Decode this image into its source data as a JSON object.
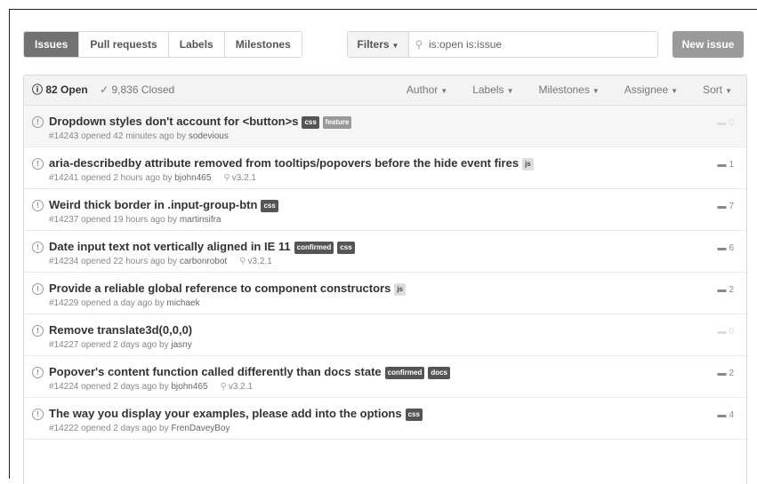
{
  "nav": {
    "tabs": [
      {
        "label": "Issues"
      },
      {
        "label": "Pull requests"
      },
      {
        "label": "Labels"
      },
      {
        "label": "Milestones"
      }
    ],
    "filters_label": "Filters",
    "search_value": "is:open is:issue",
    "new_issue_label": "New issue"
  },
  "header": {
    "open_label": "82 Open",
    "closed_label": "9,836 Closed",
    "menus": [
      "Author",
      "Labels",
      "Milestones",
      "Assignee",
      "Sort"
    ]
  },
  "issues": [
    {
      "title": "Dropdown styles don't account for <button>s",
      "labels": [
        "css",
        "feature"
      ],
      "number": "#14243",
      "opened": "opened 42 minutes ago by",
      "author": "sodevious",
      "milestone": "",
      "comments": "0"
    },
    {
      "title": "aria-describedby attribute removed from tooltips/popovers before the hide event fires",
      "labels": [
        "js"
      ],
      "number": "#14241",
      "opened": "opened 2 hours ago by",
      "author": "bjohn465",
      "milestone": "v3.2.1",
      "comments": "1"
    },
    {
      "title": "Weird thick border in .input-group-btn",
      "labels": [
        "css"
      ],
      "number": "#14237",
      "opened": "opened 19 hours ago by",
      "author": "martinsifra",
      "milestone": "",
      "comments": "7"
    },
    {
      "title": "Date input text not vertically aligned in IE 11",
      "labels": [
        "confirmed",
        "css"
      ],
      "number": "#14234",
      "opened": "opened 22 hours ago by",
      "author": "carbonrobot",
      "milestone": "v3.2.1",
      "comments": "6"
    },
    {
      "title": "Provide a reliable global reference to component constructors",
      "labels": [
        "js"
      ],
      "number": "#14229",
      "opened": "opened a day ago by",
      "author": "michaek",
      "milestone": "",
      "comments": "2"
    },
    {
      "title": "Remove translate3d(0,0,0)",
      "labels": [],
      "number": "#14227",
      "opened": "opened 2 days ago by",
      "author": "jasny",
      "milestone": "",
      "comments": "0"
    },
    {
      "title": "Popover's content function called differently than docs state",
      "labels": [
        "confirmed",
        "docs"
      ],
      "number": "#14224",
      "opened": "opened 2 days ago by",
      "author": "bjohn465",
      "milestone": "v3.2.1",
      "comments": "2"
    },
    {
      "title": "The way you display your examples, please add into the options",
      "labels": [
        "css"
      ],
      "number": "#14222",
      "opened": "opened 2 days ago by",
      "author": "FrenDaveyBoy",
      "milestone": "",
      "comments": "4"
    }
  ]
}
